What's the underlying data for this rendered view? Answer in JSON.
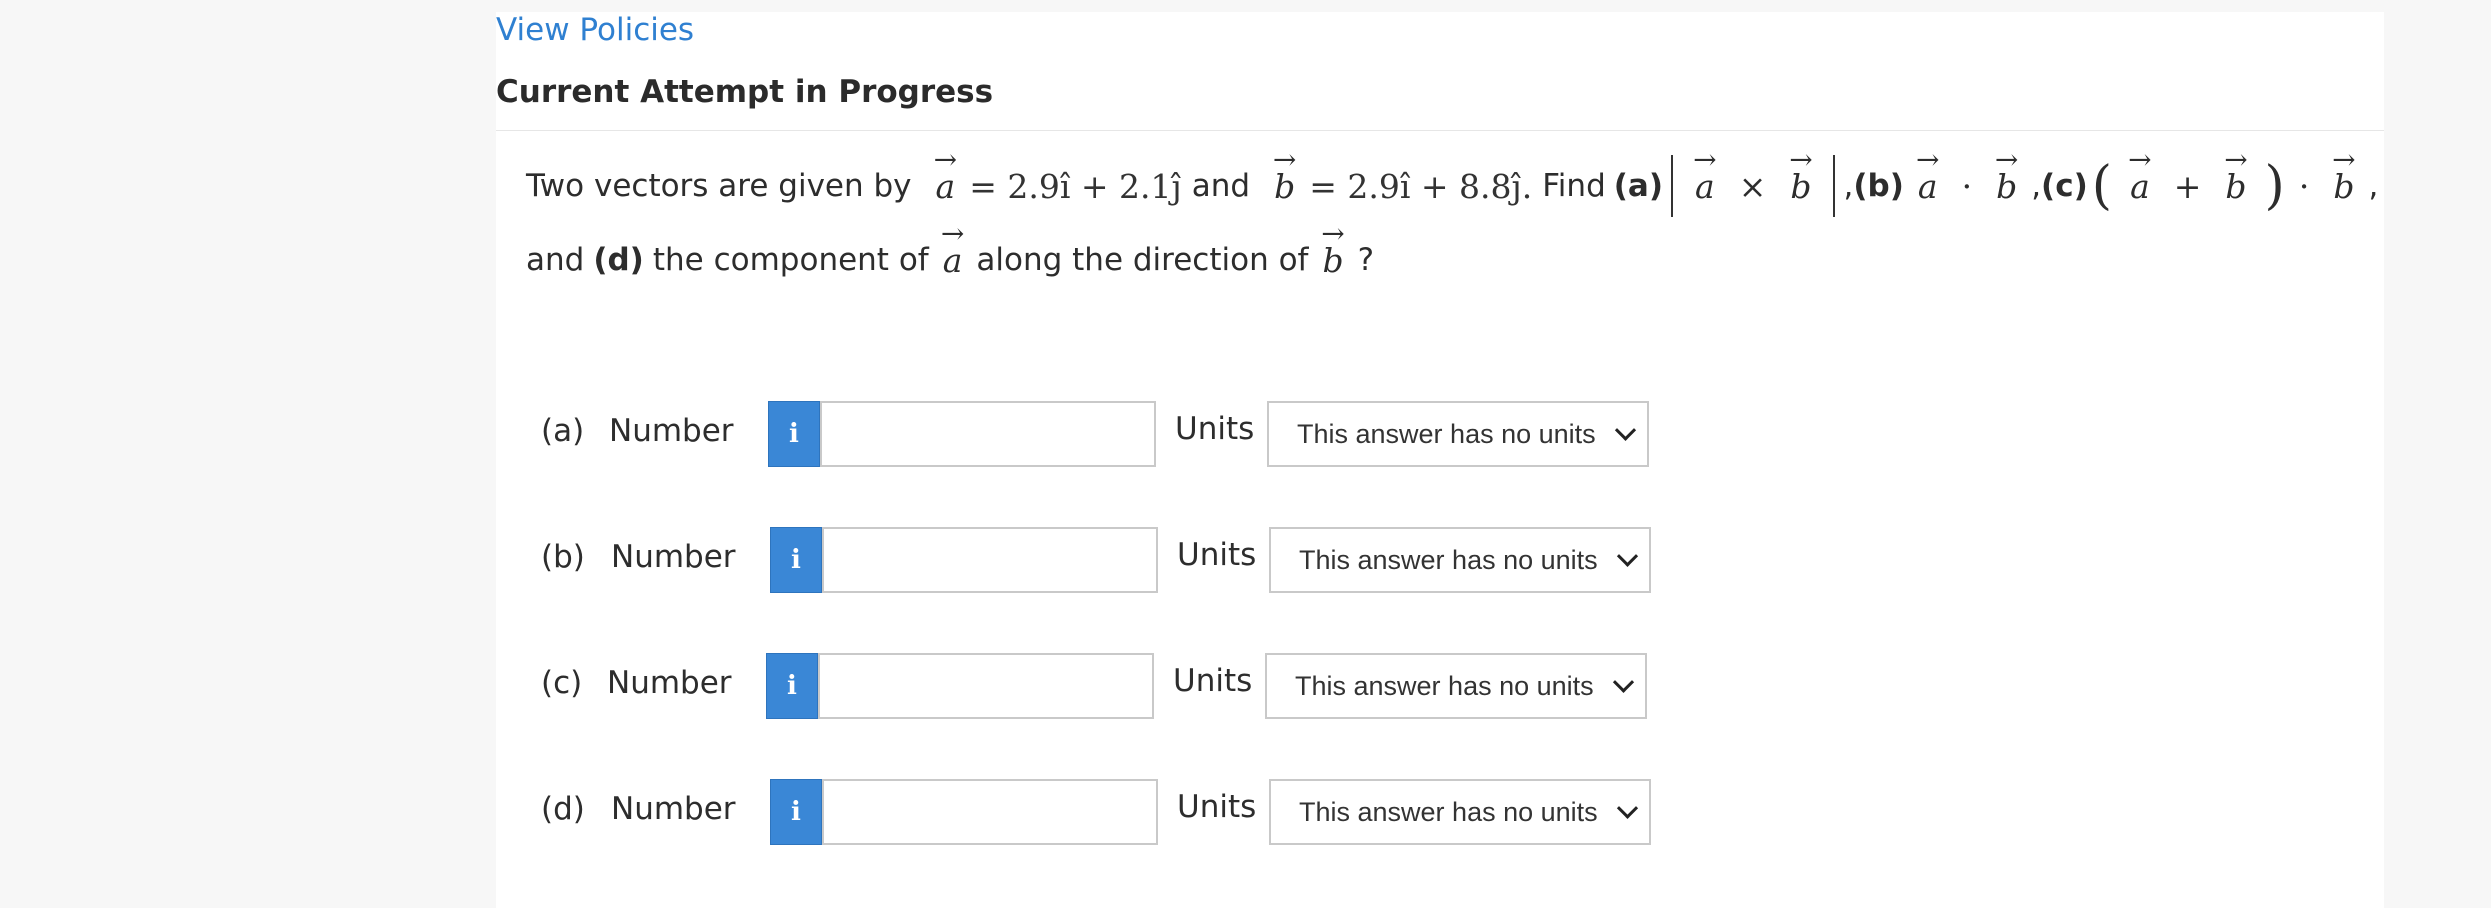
{
  "header": {
    "view_policies": "View Policies",
    "attempt_title": "Current Attempt in Progress"
  },
  "question": {
    "intro": "Two vectors are given by",
    "vec_a": "a",
    "vec_b": "b",
    "eq_a": "= 2.9î + 2.1ĵ",
    "and": "and",
    "eq_b": "= 2.9î + 8.8ĵ.",
    "find": "Find",
    "part_a_tag": "(a)",
    "cross": "×",
    "part_b_tag": "(b)",
    "dot": "·",
    "comma": ",",
    "part_c_tag": "(c)",
    "plus": "+",
    "line2_and": "and",
    "part_d_tag": "(d)",
    "line2_text": "the component of",
    "line2_along": "along the direction of",
    "qmark": "?"
  },
  "answers": [
    {
      "part": "(a)",
      "number_label": "Number",
      "info_icon": "i",
      "value": "",
      "units_label": "Units",
      "units_selected": "This answer has no units"
    },
    {
      "part": "(b)",
      "number_label": "Number",
      "info_icon": "i",
      "value": "",
      "units_label": "Units",
      "units_selected": "This answer has no units"
    },
    {
      "part": "(c)",
      "number_label": "Number",
      "info_icon": "i",
      "value": "",
      "units_label": "Units",
      "units_selected": "This answer has no units"
    },
    {
      "part": "(d)",
      "number_label": "Number",
      "info_icon": "i",
      "value": "",
      "units_label": "Units",
      "units_selected": "This answer has no units"
    }
  ],
  "colors": {
    "link": "#2f80d1",
    "info_button": "#3a87d6",
    "page_background": "#f7f7f7",
    "panel_background": "#ffffff"
  },
  "icons": {
    "info": "info-icon",
    "dropdown": "chevron-down-icon"
  }
}
